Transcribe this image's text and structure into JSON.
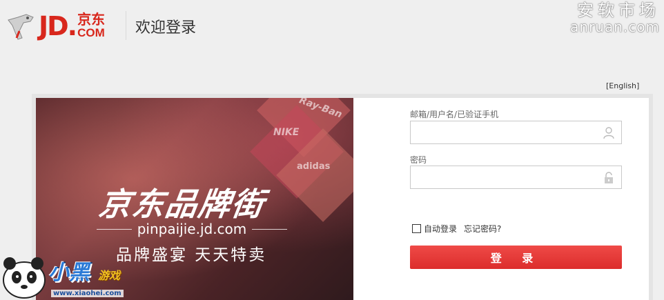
{
  "header": {
    "logo_jd": "JD.",
    "logo_cn": "京东",
    "logo_com": "COM",
    "welcome": "欢迎登录"
  },
  "watermark": {
    "cn": "安软市场",
    "en": "anruan.com"
  },
  "language_link": "[English]",
  "banner": {
    "title": "京东品牌街",
    "url": "pinpaijie.jd.com",
    "slogan": "品牌盛宴  天天特卖",
    "brands": [
      "Ray-Ban",
      "NIKE",
      "adidas"
    ]
  },
  "login": {
    "username_label": "邮箱/用户名/已验证手机",
    "username_value": "",
    "password_label": "密码",
    "password_value": "",
    "auto_login_label": "自动登录",
    "auto_login_checked": false,
    "forgot_label": "忘记密码?",
    "submit_label": "登 录",
    "submit_color": "#e4393c"
  },
  "corner_watermark": {
    "title": "小黑",
    "subtitle": "游戏",
    "url": "www.xiaohei.com"
  },
  "colors": {
    "brand_red": "#d8271c",
    "background": "#efefef"
  }
}
